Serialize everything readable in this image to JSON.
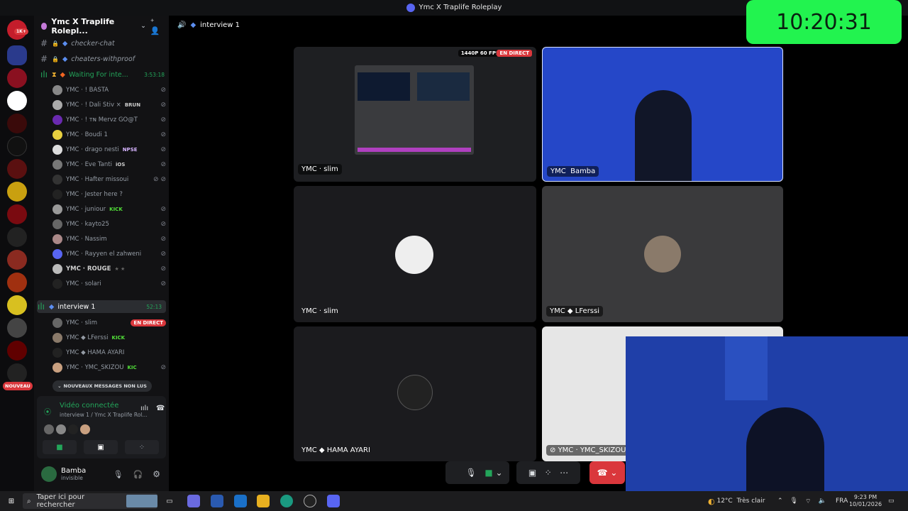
{
  "window": {
    "title": "Ymc X Traplife Roleplay"
  },
  "clock": {
    "time": "10:20:31"
  },
  "server": {
    "name": "Ymc X Traplife Rolepl..."
  },
  "channels": [
    {
      "name": "checker-chat",
      "locked": true
    },
    {
      "name": "cheaters-withproof",
      "locked": true
    }
  ],
  "waiting_channel": {
    "name": "Waiting For inte...",
    "duration": "3:53:18"
  },
  "waiting_users": [
    {
      "name": "YMC · ! BASTA",
      "tag": ""
    },
    {
      "name": "YMC · ! Dali Stiv ×",
      "tag": "BRUN"
    },
    {
      "name": "YMC · ! ᴛɴ Mervz GO@T",
      "tag": ""
    },
    {
      "name": "YMC · Boudi 1",
      "tag": ""
    },
    {
      "name": "YMC · drago nesti",
      "tag": "NPSE"
    },
    {
      "name": "YMC · Eve Tanti",
      "tag": "iOS"
    },
    {
      "name": "YMC · Hafter missoui",
      "tag": ""
    },
    {
      "name": "YMC · Jester here ?",
      "tag": ""
    },
    {
      "name": "YMC · juniour",
      "tag": "KICK"
    },
    {
      "name": "YMC · kayto25",
      "tag": ""
    },
    {
      "name": "YMC · Nassim",
      "tag": ""
    },
    {
      "name": "YMC · Rayyen el zahweni",
      "tag": ""
    },
    {
      "name": "YMC · ROUGE",
      "tag": ""
    },
    {
      "name": "YMC · solari",
      "tag": ""
    }
  ],
  "interview_channel": {
    "name": "interview 1",
    "duration": "52:13"
  },
  "interview_users": [
    {
      "name": "YMC · slim",
      "tag": "EN DIRECT"
    },
    {
      "name": "YMC ◆ LFerssi",
      "tag": "KICK"
    },
    {
      "name": "YMC ◆ HAMA AYARI",
      "tag": ""
    },
    {
      "name": "YMC · YMC_SKIZOU",
      "tag": "KIC"
    }
  ],
  "new_messages": "NOUVEAUX MESSAGES NON LUS",
  "new_badge": "NOUVEAU",
  "server_unread": "1K+",
  "voice": {
    "status": "Vidéo connectée",
    "sub": "interview 1 / Ymc X Traplife Rol..."
  },
  "user": {
    "name": "Bamba",
    "status": "invisible"
  },
  "call": {
    "title": "interview 1"
  },
  "tiles": [
    {
      "label": "YMC · slim",
      "quality": "1440P 60 FPS",
      "live": "EN DIRECT"
    },
    {
      "label_prefix": "YMC",
      "label_name": "Bamba"
    },
    {
      "label": "YMC · slim"
    },
    {
      "label": "YMC ◆ LFerssi"
    },
    {
      "label": "YMC ◆ HAMA AYARI"
    },
    {
      "label": "YMC · YMC_SKIZOU"
    }
  ],
  "taskbar": {
    "search_placeholder": "Taper ici pour rechercher",
    "weather": "12°C",
    "weather_desc": "Très clair",
    "lang": "FRA",
    "time": "9:23 PM",
    "date": "10/01/2026"
  },
  "colors": {
    "accent": "#5865f2",
    "live": "#da373c",
    "voice": "#23a55a",
    "clock_bg": "#22f34f"
  }
}
